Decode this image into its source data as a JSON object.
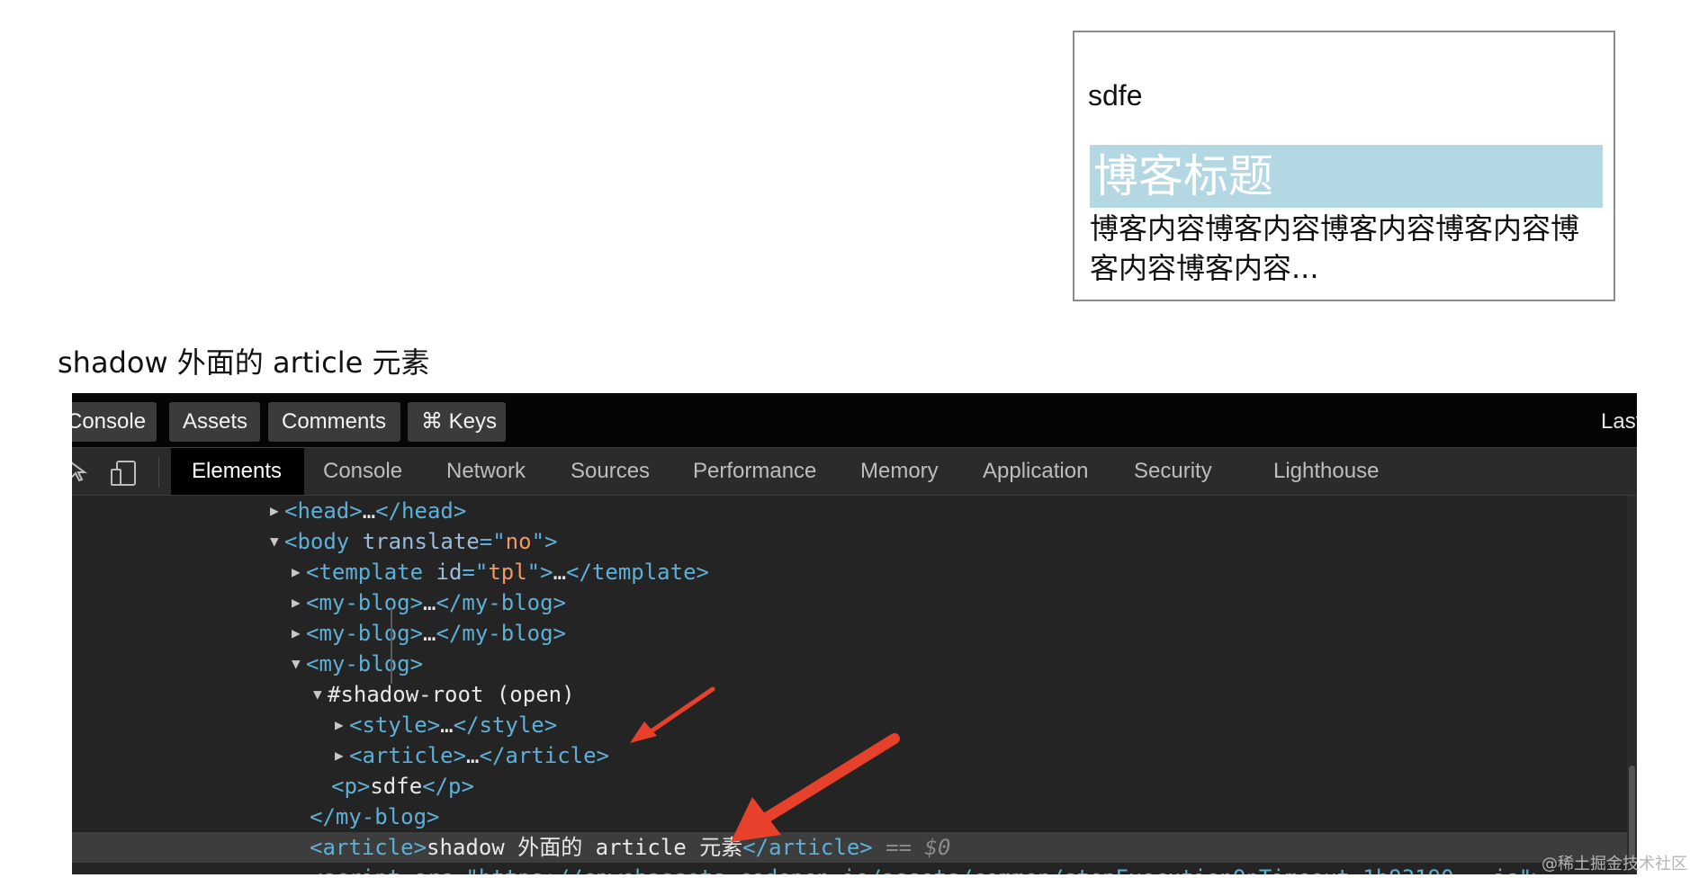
{
  "preview": {
    "paragraph": "sdfe",
    "blog_title": "博客标题",
    "blog_content": "博客内容博客内容博客内容博客内容博客内容博客内容..."
  },
  "outer_article_text": "shadow 外面的 article 元素",
  "devtools": {
    "top_buttons": [
      "Console",
      "Assets",
      "Comments",
      "⌘ Keys"
    ],
    "top_right_label": "Last",
    "tabs": [
      "Elements",
      "Console",
      "Network",
      "Sources",
      "Performance",
      "Memory",
      "Application",
      "Security",
      "Lighthouse"
    ],
    "active_tab": "Elements",
    "tree": {
      "head": {
        "open": "<head>",
        "ellipsis": "…",
        "close": "</head>"
      },
      "body": {
        "open": "<body",
        "attr": "translate",
        "eq": "=\"",
        "value": "no",
        "end": "\">"
      },
      "template": {
        "open": "<template",
        "attr": "id",
        "eq": "=\"",
        "value": "tpl",
        "end": "\">",
        "ellipsis": "…",
        "close": "</template>"
      },
      "myblog1": {
        "open": "<my-blog>",
        "ellipsis": "…",
        "close": "</my-blog>"
      },
      "myblog2": {
        "open": "<my-blog>",
        "ellipsis": "…",
        "close": "</my-blog>"
      },
      "myblog3": {
        "open": "<my-blog>"
      },
      "shadow_root": "#shadow-root (open)",
      "style": {
        "open": "<style>",
        "ellipsis": "…",
        "close": "</style>"
      },
      "article_inner": {
        "open": "<article>",
        "ellipsis": "…",
        "close": "</article>"
      },
      "p": {
        "open": "<p>",
        "text": "sdfe",
        "close": "</p>"
      },
      "myblog_close": "</my-blog>",
      "article_selected": {
        "open": "<article>",
        "text": "shadow 外面的 article 元素",
        "close": "</article>",
        "marker": " == $0"
      },
      "script_partial": "<script src=\"https://cpwebassets.codepen.io/assets/common/stopExecutionOnTimeout-1b93190...js\">"
    }
  },
  "watermark": "@稀土掘金技术社区",
  "colors": {
    "tag": "#5db0d7",
    "attr": "#9bbbdc",
    "value": "#f29766",
    "arrow": "#e8412b",
    "highlight": "#b4d7e4"
  }
}
